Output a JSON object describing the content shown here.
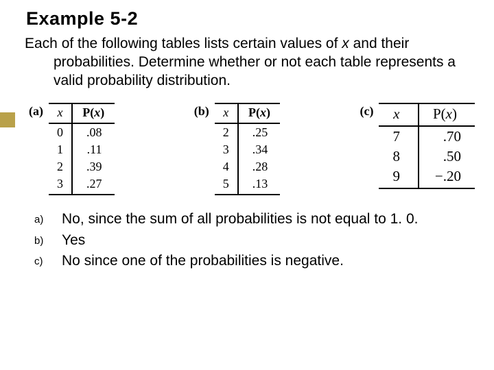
{
  "title": "Example 5-2",
  "prompt_line1": "Each of the following tables lists certain values of ",
  "prompt_var": "x",
  "prompt_line2": "and their probabilities. Determine whether or not each table represents a valid probability distribution.",
  "col_x": "x",
  "col_px_open": "P(",
  "col_px_var": "x",
  "col_px_close": ")",
  "tables": {
    "a": {
      "label": "(a)",
      "rows": [
        {
          "x": "0",
          "p": ".08"
        },
        {
          "x": "1",
          "p": ".11"
        },
        {
          "x": "2",
          "p": ".39"
        },
        {
          "x": "3",
          "p": ".27"
        }
      ]
    },
    "b": {
      "label": "(b)",
      "rows": [
        {
          "x": "2",
          "p": ".25"
        },
        {
          "x": "3",
          "p": ".34"
        },
        {
          "x": "4",
          "p": ".28"
        },
        {
          "x": "5",
          "p": ".13"
        }
      ]
    },
    "c": {
      "label": "(c)",
      "rows": [
        {
          "x": "7",
          "p": ".70"
        },
        {
          "x": "8",
          "p": ".50"
        },
        {
          "x": "9",
          "p": "−.20"
        }
      ]
    }
  },
  "answers": {
    "a": {
      "mk": "a)",
      "text": "No, since the sum of all probabilities is not equal to 1. 0."
    },
    "b": {
      "mk": "b)",
      "text": "Yes"
    },
    "c": {
      "mk": "c)",
      "text": "No since one of the probabilities is negative."
    }
  }
}
